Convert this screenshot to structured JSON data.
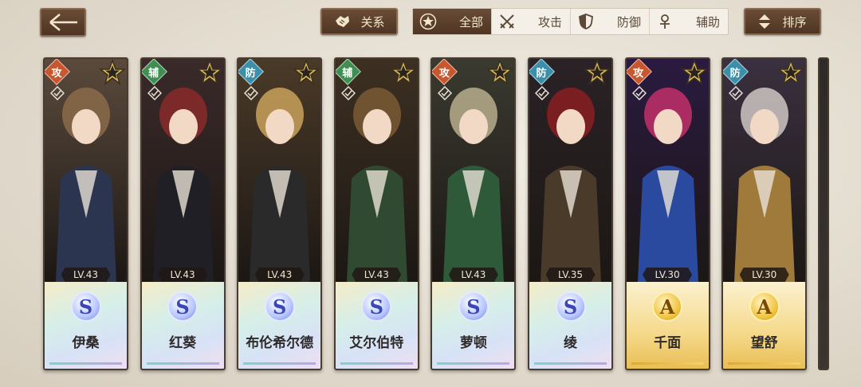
{
  "topbar": {
    "back_icon": "arrow-left-icon",
    "relation_label": "关系",
    "sort_label": "排序",
    "filters": [
      {
        "label": "全部",
        "icon": "star-badge-icon",
        "active": true
      },
      {
        "label": "攻击",
        "icon": "crossed-swords-icon",
        "active": false
      },
      {
        "label": "防御",
        "icon": "shield-icon",
        "active": false
      },
      {
        "label": "辅助",
        "icon": "support-icon",
        "active": false
      }
    ]
  },
  "colors": {
    "attack": "#c8562e",
    "support": "#3f8f52",
    "defense": "#3b8fa9",
    "brown": "#5a3f2b"
  },
  "cards": [
    {
      "role": "攻",
      "level": "LV.43",
      "rarity": "S",
      "name": "伊桑"
    },
    {
      "role": "辅",
      "level": "LV.43",
      "rarity": "S",
      "name": "红葵"
    },
    {
      "role": "防",
      "level": "LV.43",
      "rarity": "S",
      "name": "布伦希尔德"
    },
    {
      "role": "辅",
      "level": "LV.43",
      "rarity": "S",
      "name": "艾尔伯特"
    },
    {
      "role": "攻",
      "level": "LV.43",
      "rarity": "S",
      "name": "萝顿"
    },
    {
      "role": "防",
      "level": "LV.35",
      "rarity": "S",
      "name": "绫"
    },
    {
      "role": "攻",
      "level": "LV.30",
      "rarity": "A",
      "name": "千面"
    },
    {
      "role": "防",
      "level": "LV.30",
      "rarity": "A",
      "name": "望舒"
    }
  ]
}
